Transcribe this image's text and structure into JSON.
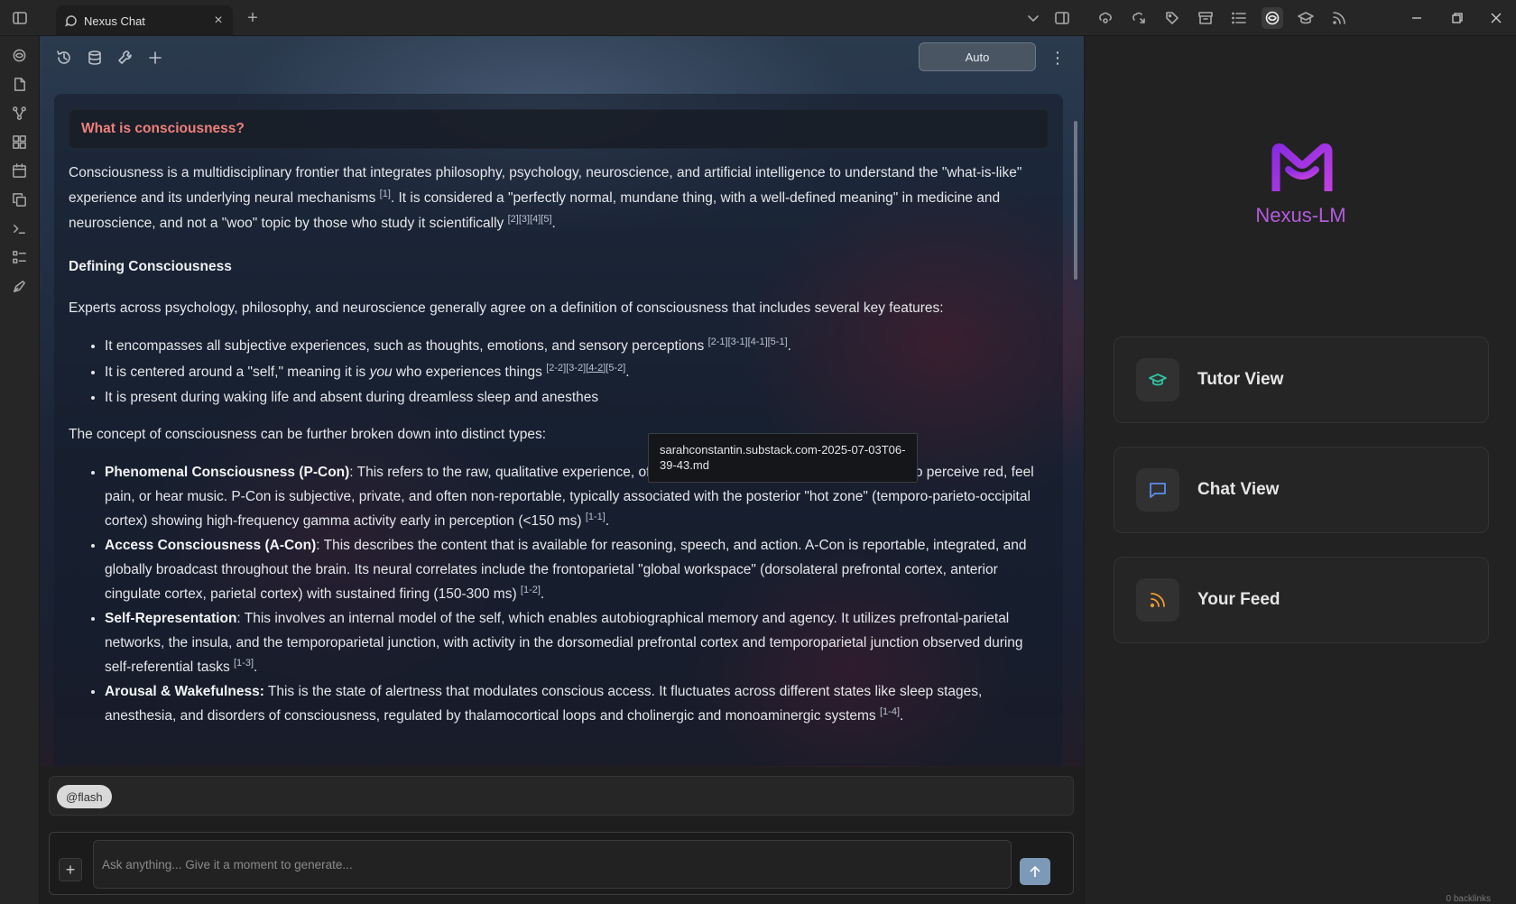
{
  "tab": {
    "title": "Nexus Chat"
  },
  "toolbar": {
    "mode_label": "Auto"
  },
  "question": "What is consciousness?",
  "answer": {
    "intro": {
      "t1": "Consciousness is a multidisciplinary frontier that integrates philosophy, psychology, neuroscience, and artificial intelligence to understand the \"what-is-like\" experience and its underlying neural mechanisms ",
      "c1": "[1]",
      "t2": ". It is considered a \"perfectly normal, mundane thing, with a well-defined meaning\" in medicine and neuroscience, and not a \"woo\" topic by those who study it scientifically ",
      "c2": "[2][3][4][5]",
      "t3": "."
    },
    "heading_defining": "Defining Consciousness",
    "experts_para": "Experts across psychology, philosophy, and neuroscience generally agree on a definition of consciousness that includes several key features:",
    "features": [
      {
        "text": "It encompasses all subjective experiences, such as thoughts, emotions, and sensory perceptions ",
        "cite": "[2-1][3-1][4-1][5-1]"
      },
      {
        "pre": "It is centered around a \"self,\" meaning it is ",
        "em": "you",
        "post": " who experiences things ",
        "cite_a": "[2-2][3-2]",
        "cite_b": "[4-2]",
        "cite_c": "[5-2]"
      },
      {
        "text": "It is present during waking life and absent during dreamless sleep and anesthes"
      }
    ],
    "types_intro": "The concept of consciousness can be further broken down into distinct types:",
    "types": [
      {
        "name": "Phenomenal Consciousness (P-Con)",
        "text": ": This refers to the raw, qualitative experience, often called \"qualia.\" It is the \"what it is like\" to perceive red, feel pain, or hear music. P-Con is subjective, private, and often non-reportable, typically associated with the posterior \"hot zone\" (temporo-parieto-occipital cortex) showing high-frequency gamma activity early in perception (<150 ms) ",
        "cite": "[1-1]"
      },
      {
        "name": "Access Consciousness (A-Con)",
        "text": ": This describes the content that is available for reasoning, speech, and action. A-Con is reportable, integrated, and globally broadcast throughout the brain. Its neural correlates include the frontoparietal \"global workspace\" (dorsolateral prefrontal cortex, anterior cingulate cortex, parietal cortex) with sustained firing (150-300 ms) ",
        "cite": "[1-2]"
      },
      {
        "name": "Self-Representation",
        "text": ": This involves an internal model of the self, which enables autobiographical memory and agency. It utilizes prefrontal-parietal networks, the insula, and the temporoparietal junction, with activity in the dorsomedial prefrontal cortex and temporoparietal junction observed during self-referential tasks ",
        "cite": "[1-3]"
      },
      {
        "name": "Arousal & Wakefulness:",
        "text": " This is the state of alertness that modulates conscious access. It fluctuates across different states like sleep stages, anesthesia, and disorders of consciousness, regulated by thalamocortical loops and cholinergic and monoaminergic systems ",
        "cite": "[1-4]"
      }
    ]
  },
  "tooltip": "sarahconstantin.substack.com-2025-07-03T06-39-43.md",
  "composer": {
    "mention_chip": "@flash",
    "placeholder": "Ask anything... Give it a moment to generate..."
  },
  "right_panel": {
    "brand": "Nexus-LM",
    "cards": [
      {
        "label": "Tutor View",
        "icon": "graduation-cap-icon",
        "color": "#2ec4a0"
      },
      {
        "label": "Chat View",
        "icon": "chat-bubble-icon",
        "color": "#5b8def"
      },
      {
        "label": "Your Feed",
        "icon": "rss-icon",
        "color": "#f0a030"
      }
    ],
    "status": "0 backlinks"
  },
  "colors": {
    "accent_question": "#ef7f7a",
    "brand": "#b25bdc",
    "send": "#7d99b8"
  }
}
